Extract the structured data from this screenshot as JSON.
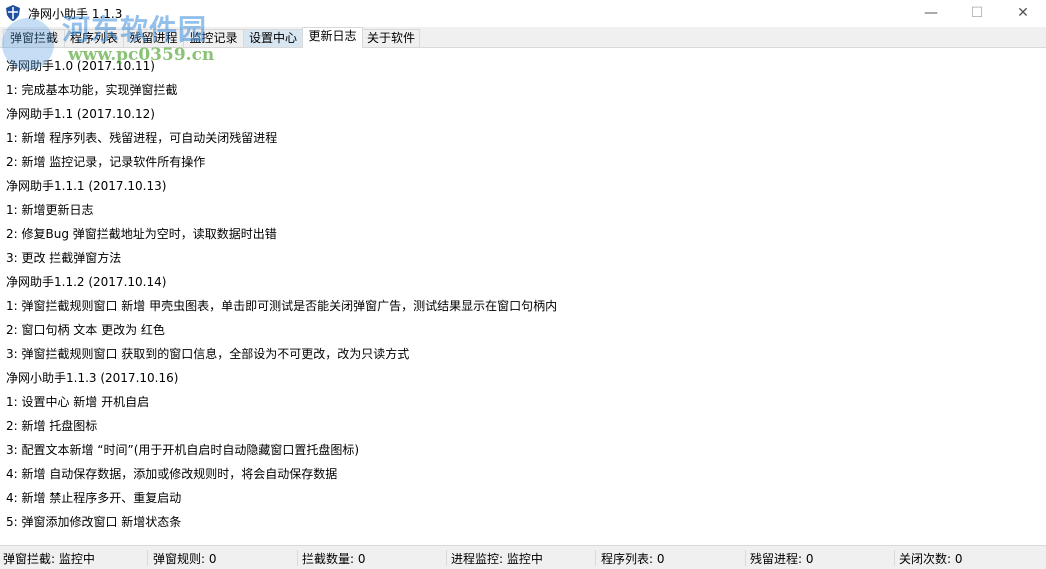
{
  "window": {
    "title": "净网小助手 1.1.3",
    "minimize": "—",
    "maximize": "☐",
    "close": "✕"
  },
  "tabs": [
    "弹窗拦截",
    "程序列表",
    "残留进程",
    "监控记录",
    "设置中心",
    "更新日志",
    "关于软件"
  ],
  "active_tab": "更新日志",
  "log": [
    "净网助手1.0 (2017.10.11)",
    "1: 完成基本功能，实现弹窗拦截",
    "净网助手1.1 (2017.10.12)",
    "1: 新增 程序列表、残留进程，可自动关闭残留进程",
    "2: 新增 监控记录，记录软件所有操作",
    "净网助手1.1.1 (2017.10.13)",
    "1: 新增更新日志",
    "2: 修复Bug 弹窗拦截地址为空时，读取数据时出错",
    "3: 更改 拦截弹窗方法",
    "净网助手1.1.2 (2017.10.14)",
    "1: 弹窗拦截规则窗口 新增 甲壳虫图表，单击即可测试是否能关闭弹窗广告，测试结果显示在窗口句柄内",
    "2: 窗口句柄 文本 更改为 红色",
    "3: 弹窗拦截规则窗口 获取到的窗口信息，全部设为不可更改，改为只读方式",
    "净网小助手1.1.3 (2017.10.16)",
    "1: 设置中心 新增 开机自启",
    "2: 新增 托盘图标",
    "3: 配置文本新增 “时间”(用于开机自启时自动隐藏窗口置托盘图标)",
    "4: 新增 自动保存数据，添加或修改规则时，将会自动保存数据",
    "4: 新增 禁止程序多开、重复启动",
    "5: 弹窗添加修改窗口 新增状态条"
  ],
  "status": [
    "弹窗拦截: 监控中",
    "弹窗规则: 0",
    "拦截数量: 0",
    "进程监控: 监控中",
    "程序列表: 0",
    "残留进程: 0",
    "关闭次数: 0"
  ],
  "watermark": {
    "name": "河东软件园",
    "url": "www.pc0359.cn"
  }
}
